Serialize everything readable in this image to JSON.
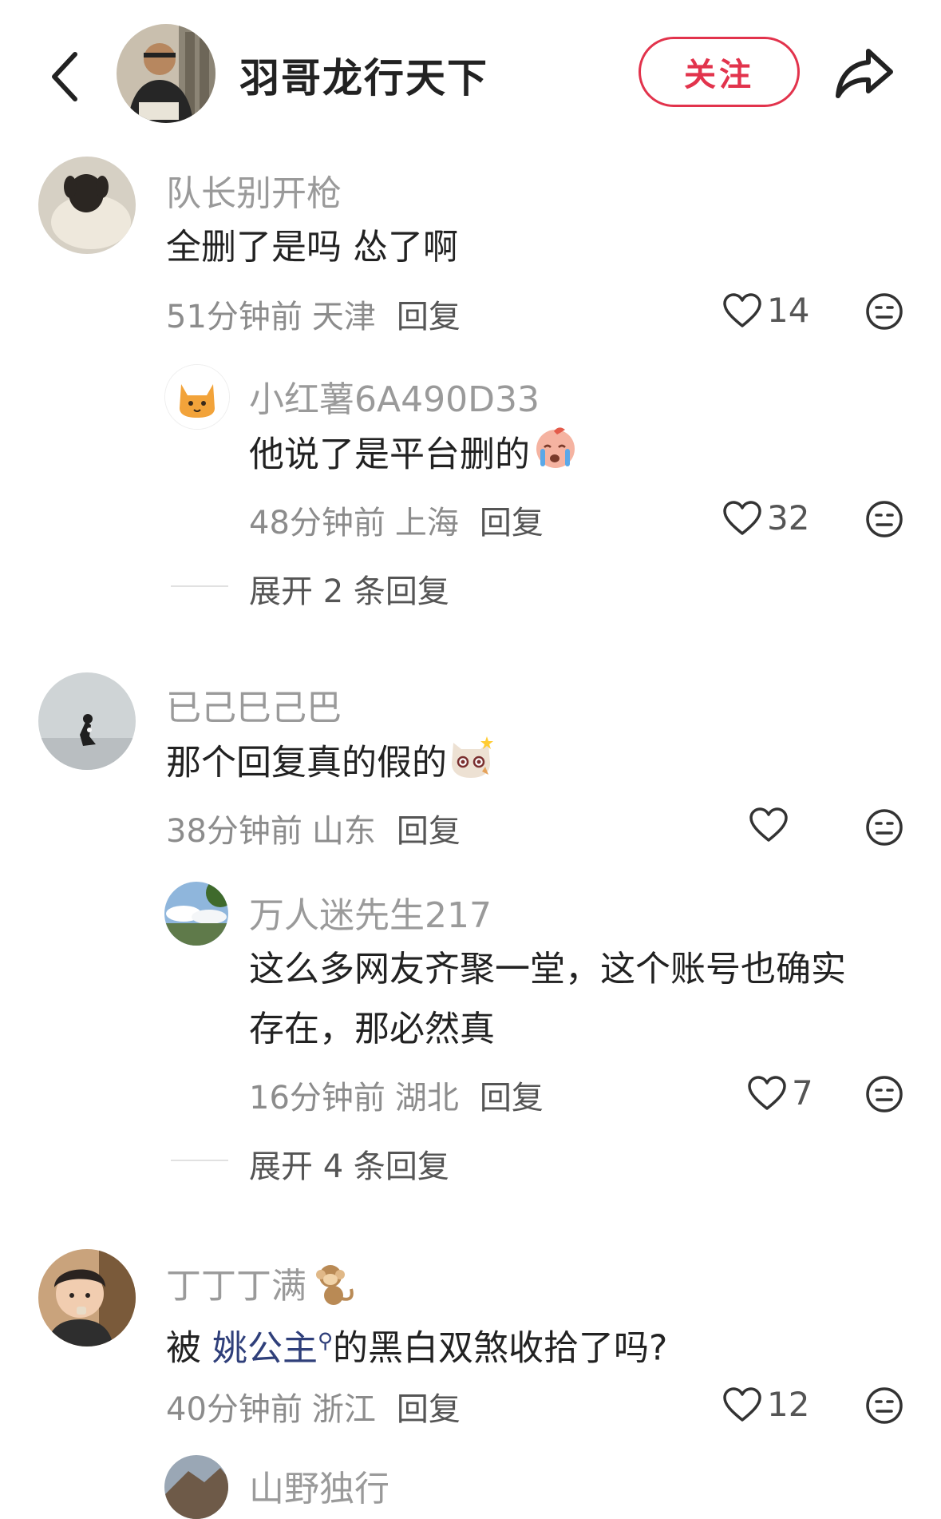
{
  "header": {
    "author_name": "羽哥龙行天下",
    "follow_label": "关注",
    "back_icon": "chevron-left-icon",
    "share_icon": "share-arrow-icon"
  },
  "comments": [
    {
      "user": "队长别开枪",
      "text": "全删了是吗 怂了啊",
      "time": "51分钟前",
      "location": "天津",
      "reply_label": "回复",
      "likes": "14",
      "replies": [
        {
          "user": "小红薯6A490D33",
          "text": "他说了是平台删的",
          "time": "48分钟前",
          "location": "上海",
          "reply_label": "回复",
          "likes": "32"
        }
      ],
      "expand_label": "展开 2 条回复"
    },
    {
      "user": "已己巳己巴",
      "text": "那个回复真的假的",
      "time": "38分钟前",
      "location": "山东",
      "reply_label": "回复",
      "likes": "",
      "replies": [
        {
          "user": "万人迷先生217",
          "text_line1": "这么多网友齐聚一堂，这个账号也确实",
          "text_line2": "存在，那必然真",
          "time": "16分钟前",
          "location": "湖北",
          "reply_label": "回复",
          "likes": "7"
        }
      ],
      "expand_label": "展开 4 条回复"
    },
    {
      "user": "丁丁丁满",
      "text_before": "被",
      "mention": "姚公主",
      "text_after": "的黑白双煞收拾了吗?",
      "time": "40分钟前",
      "location": "浙江",
      "reply_label": "回复",
      "likes": "12"
    },
    {
      "user": "山野独行"
    }
  ],
  "colors": {
    "accent": "#e2334c",
    "username": "#9a9a9a",
    "mention": "#2f3f7a"
  }
}
